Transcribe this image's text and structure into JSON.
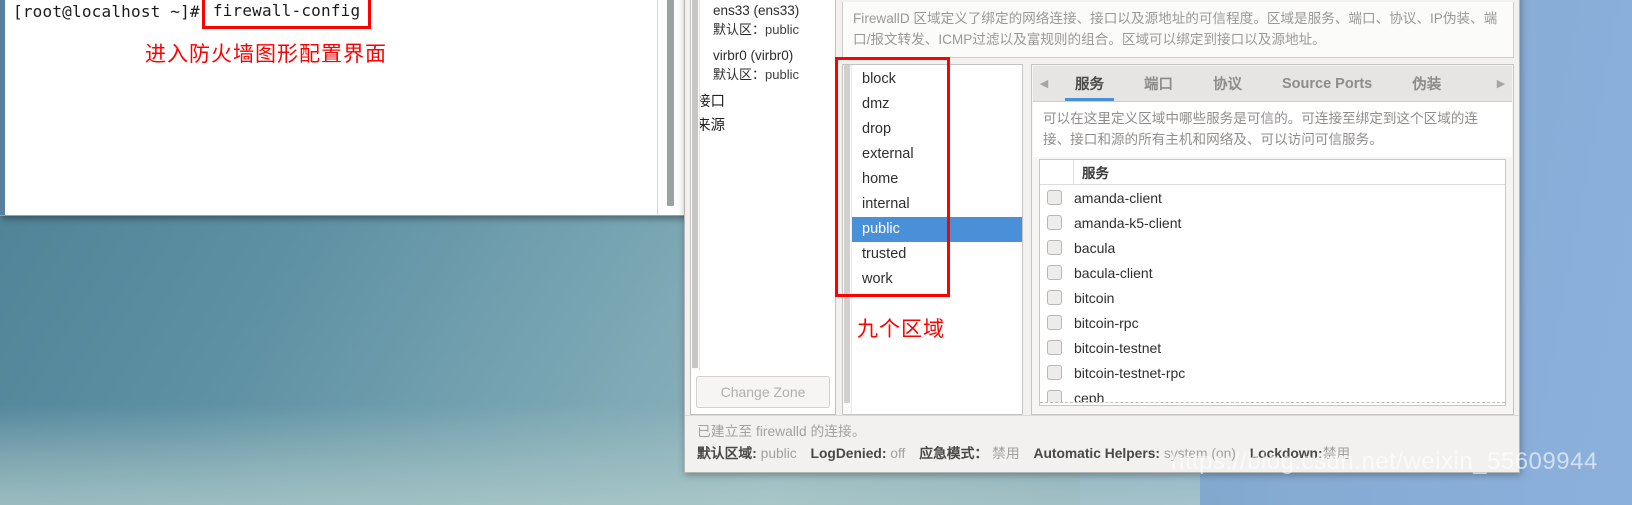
{
  "terminal": {
    "prompt": "[root@localhost ~]#",
    "command": "firewall-config",
    "annotation": "进入防火墙图形配置界面"
  },
  "firewall": {
    "connections": [
      {
        "name": "ens33 (ens33)",
        "default_zone_label": "默认区：",
        "default_zone_value": "public"
      },
      {
        "name": "virbr0 (virbr0)",
        "default_zone_label": "默认区：",
        "default_zone_value": "public"
      }
    ],
    "tree_roots": [
      {
        "label": "接口"
      },
      {
        "label": "来源"
      }
    ],
    "change_zone_button": "Change Zone",
    "zone_description": "FirewallD 区域定义了绑定的网络连接、接口以及源地址的可信程度。区域是服务、端口、协议、IP伪装、端口/报文转发、ICMP过滤以及富规则的组合。区域可以绑定到接口以及源地址。",
    "zones": [
      {
        "name": "block",
        "selected": false
      },
      {
        "name": "dmz",
        "selected": false
      },
      {
        "name": "drop",
        "selected": false
      },
      {
        "name": "external",
        "selected": false
      },
      {
        "name": "home",
        "selected": false
      },
      {
        "name": "internal",
        "selected": false
      },
      {
        "name": "public",
        "selected": true
      },
      {
        "name": "trusted",
        "selected": false
      },
      {
        "name": "work",
        "selected": false
      }
    ],
    "zones_annotation": "九个区域",
    "detail_tabs": [
      {
        "label": "服务",
        "active": true
      },
      {
        "label": "端口",
        "active": false
      },
      {
        "label": "协议",
        "active": false
      },
      {
        "label": "Source Ports",
        "active": false
      },
      {
        "label": "伪装",
        "active": false
      }
    ],
    "tab_scroll_left": "◀",
    "tab_scroll_right": "▶",
    "service_description": "可以在这里定义区域中哪些服务是可信的。可连接至绑定到这个区域的连接、接口和源的所有主机和网络及、可以访问可信服务。",
    "service_column_header": "服务",
    "services": [
      {
        "name": "amanda-client",
        "checked": false
      },
      {
        "name": "amanda-k5-client",
        "checked": false
      },
      {
        "name": "bacula",
        "checked": false
      },
      {
        "name": "bacula-client",
        "checked": false
      },
      {
        "name": "bitcoin",
        "checked": false
      },
      {
        "name": "bitcoin-rpc",
        "checked": false
      },
      {
        "name": "bitcoin-testnet",
        "checked": false
      },
      {
        "name": "bitcoin-testnet-rpc",
        "checked": false
      },
      {
        "name": "ceph",
        "checked": false
      }
    ],
    "status": {
      "connection": "已建立至 firewalld 的连接。",
      "default_zone_label": "默认区域:",
      "default_zone_value": "public",
      "log_denied_label": "LogDenied:",
      "log_denied_value": "off",
      "panic_label": "应急模式：",
      "panic_value": "禁用",
      "helpers_label": "Automatic Helpers:",
      "helpers_value": "system (on)",
      "lockdown_label": "Lockdown:",
      "lockdown_value": "禁用"
    }
  },
  "watermark": "https://blog.csdn.net/weixin_55609944",
  "colors": {
    "accent_blue": "#4a90d9",
    "annotation_red": "#fe0000",
    "desktop_teal": "#5d90a3"
  }
}
